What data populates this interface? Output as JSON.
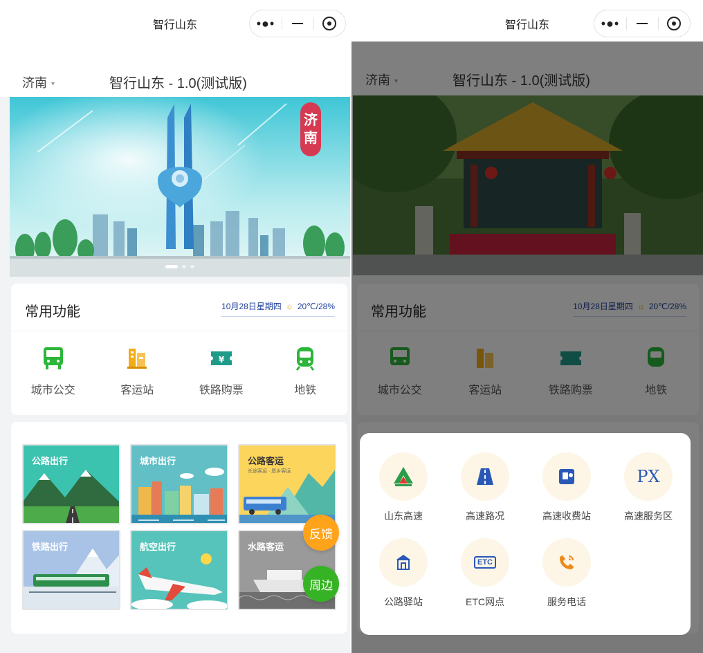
{
  "left": {
    "nav": {
      "title": "智行山东"
    },
    "header": {
      "city": "济南",
      "app_title": "智行山东 - 1.0(测试版)"
    },
    "banner": {
      "badge": "济南"
    },
    "functions": {
      "title": "常用功能",
      "date": "10月28日星期四",
      "weather": "20℃/28%",
      "items": [
        {
          "label": "城市公交",
          "icon": "bus-icon",
          "color": "#2cb63a"
        },
        {
          "label": "客运站",
          "icon": "station-icon",
          "color": "#f3ab16"
        },
        {
          "label": "铁路购票",
          "icon": "ticket-icon",
          "color": "#1f9b8a"
        },
        {
          "label": "地铁",
          "icon": "subway-icon",
          "color": "#2cb63a"
        }
      ]
    },
    "tiles": [
      {
        "title": "公路出行"
      },
      {
        "title": "城市出行"
      },
      {
        "title": "公路客运",
        "subtitle": "长途客运 · 愿乡客运"
      },
      {
        "title": "铁路出行"
      },
      {
        "title": "航空出行"
      },
      {
        "title": "水路客运"
      }
    ],
    "floating": {
      "feedback": "反馈",
      "nearby": "周边"
    }
  },
  "right": {
    "nav": {
      "title": "智行山东"
    },
    "header": {
      "city": "济南",
      "app_title": "智行山东 - 1.0(测试版)"
    },
    "functions": {
      "title": "常用功能",
      "date": "10月28日星期四",
      "weather": "20℃/28%",
      "items": [
        {
          "label": "城市公交"
        },
        {
          "label": "客运站"
        },
        {
          "label": "铁路购票"
        },
        {
          "label": "地铁"
        }
      ]
    },
    "popup": {
      "items": [
        {
          "label": "山东高速",
          "icon": "sdhs-logo-icon"
        },
        {
          "label": "高速路况",
          "icon": "highway-road-icon"
        },
        {
          "label": "高速收费站",
          "icon": "toll-station-icon"
        },
        {
          "label": "高速服务区",
          "icon": "service-area-icon",
          "glyph": "PX"
        },
        {
          "label": "公路驿站",
          "icon": "road-post-icon"
        },
        {
          "label": "ETC网点",
          "icon": "etc-icon",
          "glyph": "ETC"
        },
        {
          "label": "服务电话",
          "icon": "phone-icon"
        }
      ]
    }
  }
}
